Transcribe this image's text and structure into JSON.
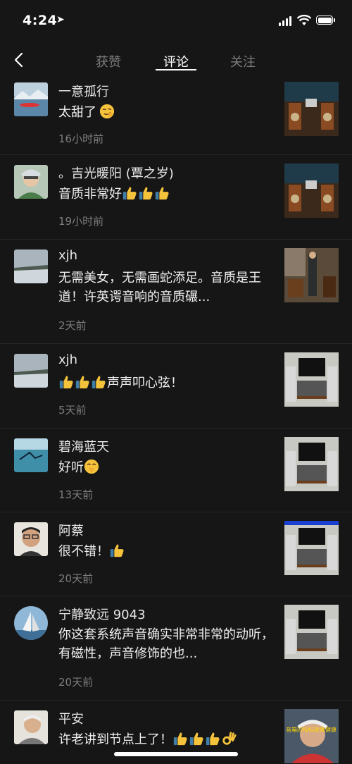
{
  "status": {
    "time": "4:24"
  },
  "nav": {
    "tabs": [
      "获赞",
      "评论",
      "关注"
    ],
    "active": 1
  },
  "comments": [
    {
      "name": "一意孤行",
      "text": "太甜了",
      "emojis": [
        "smirk"
      ],
      "time": "16小时前"
    },
    {
      "name": "。吉光暖阳 (覃之岁)",
      "text": "音质非常好",
      "emojis": [
        "thumbs-up",
        "thumbs-up",
        "thumbs-up"
      ],
      "time": "19小时前"
    },
    {
      "name": "xjh",
      "text": "无需美女，无需画蛇添足。音质是王道！许英谔音响的音质碾...",
      "emojis": [],
      "time": "2天前"
    },
    {
      "name": "xjh",
      "text": "声声叩心弦！",
      "emojis_before": [
        "thumbs-up",
        "thumbs-up",
        "thumbs-up"
      ],
      "emojis": [],
      "time": "5天前"
    },
    {
      "name": "碧海蓝天",
      "text": "好听",
      "emojis": [
        "shush"
      ],
      "time": "13天前"
    },
    {
      "name": "阿蔡",
      "text": "很不错！",
      "emojis": [
        "thumbs-up"
      ],
      "time": "20天前"
    },
    {
      "name": "宁静致远 9043",
      "text": "你这套系统声音确实非常非常的动听，有磁性，声音修饰的也...",
      "emojis": [],
      "time": "20天前"
    },
    {
      "name": "平安",
      "text": "许老讲到节点上了！",
      "emojis": [
        "thumbs-up",
        "thumbs-up",
        "thumbs-up",
        "ok-hand"
      ],
      "time": ""
    }
  ],
  "thumb_caption": "音箱的指标就像健康"
}
